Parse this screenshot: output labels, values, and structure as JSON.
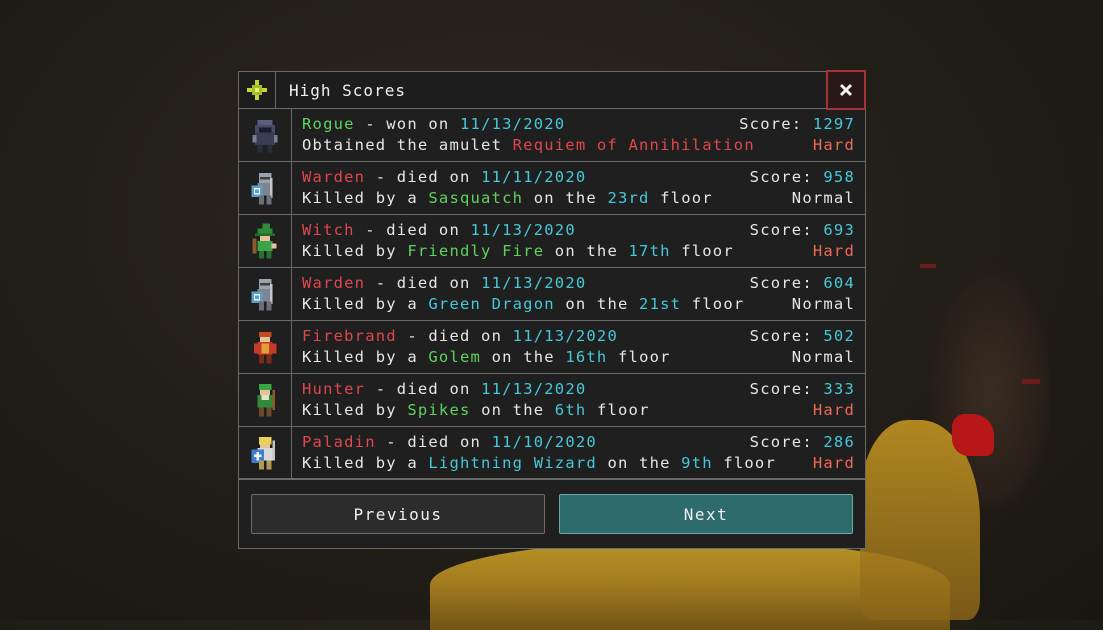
{
  "colors": {
    "class_won": "#5ed35e",
    "class_died": "#e0474d",
    "highlight": "#45c9d8",
    "hard": "#ee6a55",
    "normal": "#e6e6e6",
    "next_button": "#2e6b6b",
    "close_border": "#a23636"
  },
  "dialog": {
    "title": "High Scores",
    "title_icon": "compass-rose-icon",
    "close_icon": "close-icon"
  },
  "scores": [
    {
      "avatar_icon": "rogue-avatar-icon",
      "class": "Rogue",
      "verb": " - won on ",
      "date": "11/13/2020",
      "line2_parts": [
        {
          "t": "Obtained the amulet ",
          "c": "white"
        },
        {
          "t": "Requiem of Annihilation",
          "c": "red"
        }
      ],
      "score_label": "Score: ",
      "score": "1297",
      "difficulty": "Hard",
      "class_color": "green"
    },
    {
      "avatar_icon": "warden-avatar-icon",
      "class": "Warden",
      "verb": " - died on ",
      "date": "11/11/2020",
      "line2_parts": [
        {
          "t": "Killed by a ",
          "c": "white"
        },
        {
          "t": "Sasquatch",
          "c": "green"
        },
        {
          "t": " on the ",
          "c": "white"
        },
        {
          "t": "23rd",
          "c": "cyan"
        },
        {
          "t": " floor",
          "c": "white"
        }
      ],
      "score_label": "Score: ",
      "score": "958",
      "difficulty": "Normal",
      "class_color": "red"
    },
    {
      "avatar_icon": "witch-avatar-icon",
      "class": "Witch",
      "verb": " - died on ",
      "date": "11/13/2020",
      "line2_parts": [
        {
          "t": "Killed by ",
          "c": "white"
        },
        {
          "t": "Friendly Fire",
          "c": "green"
        },
        {
          "t": " on the ",
          "c": "white"
        },
        {
          "t": "17th",
          "c": "cyan"
        },
        {
          "t": " floor",
          "c": "white"
        }
      ],
      "score_label": "Score: ",
      "score": "693",
      "difficulty": "Hard",
      "class_color": "red"
    },
    {
      "avatar_icon": "warden-avatar-icon",
      "class": "Warden",
      "verb": " - died on ",
      "date": "11/13/2020",
      "line2_parts": [
        {
          "t": "Killed by a ",
          "c": "white"
        },
        {
          "t": "Green Dragon",
          "c": "cyan"
        },
        {
          "t": " on the ",
          "c": "white"
        },
        {
          "t": "21st",
          "c": "cyan"
        },
        {
          "t": " floor",
          "c": "white"
        }
      ],
      "score_label": "Score: ",
      "score": "604",
      "difficulty": "Normal",
      "class_color": "red"
    },
    {
      "avatar_icon": "firebrand-avatar-icon",
      "class": "Firebrand",
      "verb": " - died on ",
      "date": "11/13/2020",
      "line2_parts": [
        {
          "t": "Killed by a ",
          "c": "white"
        },
        {
          "t": "Golem",
          "c": "green"
        },
        {
          "t": " on the ",
          "c": "white"
        },
        {
          "t": "16th",
          "c": "cyan"
        },
        {
          "t": " floor",
          "c": "white"
        }
      ],
      "score_label": "Score: ",
      "score": "502",
      "difficulty": "Normal",
      "class_color": "red"
    },
    {
      "avatar_icon": "hunter-avatar-icon",
      "class": "Hunter",
      "verb": " - died on ",
      "date": "11/13/2020",
      "line2_parts": [
        {
          "t": "Killed by ",
          "c": "white"
        },
        {
          "t": "Spikes",
          "c": "green"
        },
        {
          "t": " on the ",
          "c": "white"
        },
        {
          "t": "6th",
          "c": "cyan"
        },
        {
          "t": " floor",
          "c": "white"
        }
      ],
      "score_label": "Score: ",
      "score": "333",
      "difficulty": "Hard",
      "class_color": "red"
    },
    {
      "avatar_icon": "paladin-avatar-icon",
      "class": "Paladin",
      "verb": " - died on ",
      "date": "11/10/2020",
      "line2_parts": [
        {
          "t": "Killed by a ",
          "c": "white"
        },
        {
          "t": "Lightning Wizard",
          "c": "cyan"
        },
        {
          "t": " on the ",
          "c": "white"
        },
        {
          "t": "9th",
          "c": "cyan"
        },
        {
          "t": " floor",
          "c": "white"
        }
      ],
      "score_label": "Score: ",
      "score": "286",
      "difficulty": "Hard",
      "class_color": "red"
    }
  ],
  "buttons": {
    "previous": "Previous",
    "next": "Next"
  }
}
